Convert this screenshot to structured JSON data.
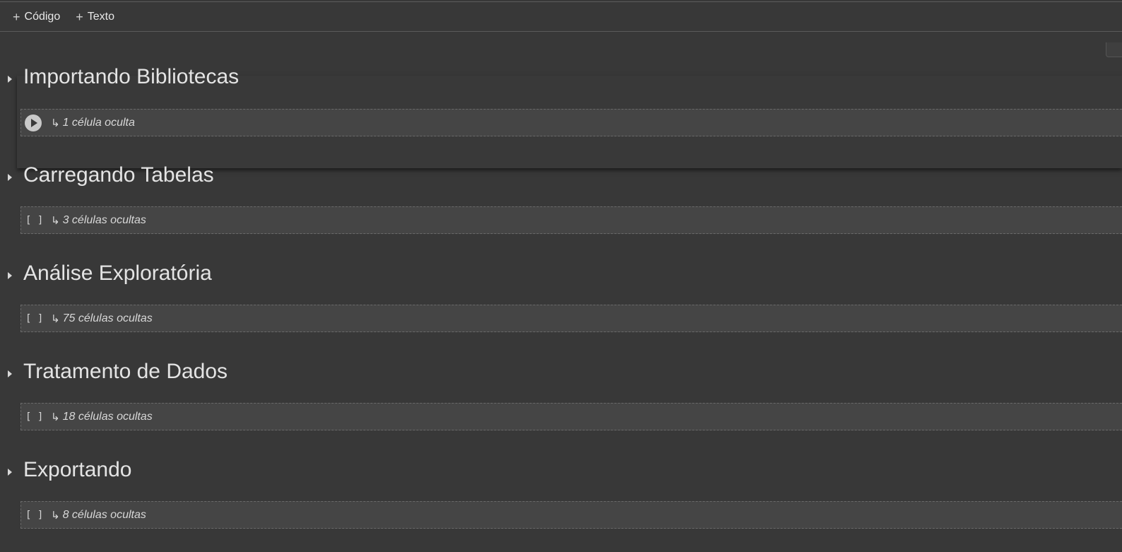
{
  "toolbar": {
    "add_code_label": "Código",
    "add_text_label": "Texto"
  },
  "sections": [
    {
      "title": "Importando Bibliotecas",
      "hidden_label": "1 célula oculta",
      "cell_marker": "",
      "selected": true
    },
    {
      "title": "Carregando Tabelas",
      "hidden_label": "3 células ocultas",
      "cell_marker": "[ ]",
      "selected": false
    },
    {
      "title": "Análise Exploratória",
      "hidden_label": "75 células ocultas",
      "cell_marker": "[ ]",
      "selected": false
    },
    {
      "title": "Tratamento de Dados",
      "hidden_label": "18 células ocultas",
      "cell_marker": "[ ]",
      "selected": false
    },
    {
      "title": "Exportando",
      "hidden_label": "8 células ocultas",
      "cell_marker": "[ ]",
      "selected": false
    }
  ],
  "icons": {
    "hidden_cells_glyph": "↳",
    "caret": "caret-right-icon",
    "add": "plus-icon"
  }
}
